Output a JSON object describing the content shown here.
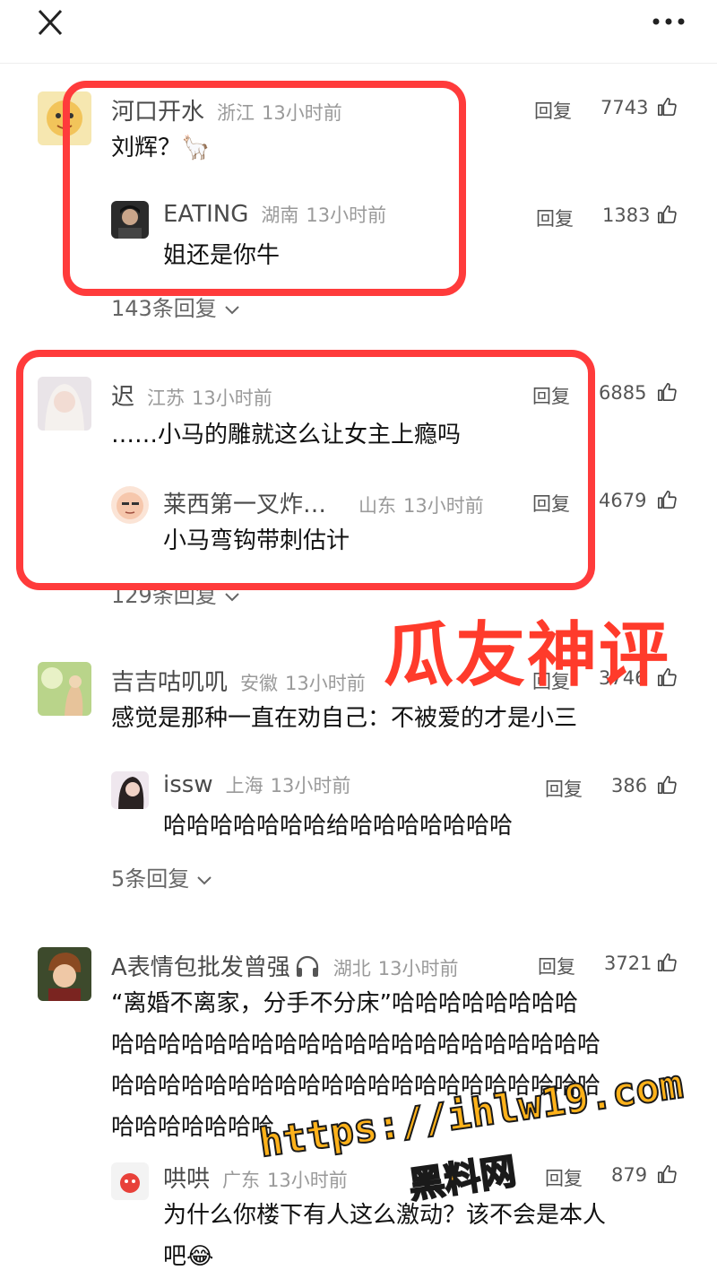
{
  "topbar": {
    "close_icon": "close-icon",
    "more_icon": "more-icon"
  },
  "labels": {
    "reply": "回复"
  },
  "comments": [
    {
      "name": "河口开水",
      "region": "浙江",
      "time": "13小时前",
      "likes": "7743",
      "text": "刘辉？🦙",
      "reply": {
        "name": "EATING",
        "region": "湖南",
        "time": "13小时前",
        "likes": "1383",
        "text": "姐还是你牛"
      },
      "more": "143条回复"
    },
    {
      "name": "迟",
      "region": "江苏",
      "time": "13小时前",
      "likes": "6885",
      "text": "……小马的雕就这么让女主上瘾吗",
      "reply": {
        "name": "莱西第一叉炸…",
        "region": "山东",
        "time": "13小时前",
        "likes": "4679",
        "text": "小马弯钩带刺估计"
      },
      "more": "129条回复"
    },
    {
      "name": "吉吉咕叽叽",
      "region": "安徽",
      "time": "13小时前",
      "likes": "3746",
      "text": "感觉是那种一直在劝自己：不被爱的才是小三",
      "reply": {
        "name": "issw",
        "region": "上海",
        "time": "13小时前",
        "likes": "386",
        "text": "哈哈哈哈哈哈哈给哈哈哈哈哈哈哈"
      },
      "more": "5条回复"
    },
    {
      "name": "A表情包批发曾强",
      "region": "湖北",
      "time": "13小时前",
      "likes": "3721",
      "text_lines": [
        "“离婚不离家，分手不分床”哈哈哈哈哈哈哈哈",
        "哈哈哈哈哈哈哈哈哈哈哈哈哈哈哈哈哈哈哈哈哈",
        "哈哈哈哈哈哈哈哈哈哈哈哈哈哈哈哈哈哈哈哈哈",
        "哈哈哈哈哈哈哈"
      ],
      "reply": {
        "name": "哄哄",
        "region": "广东",
        "time": "13小时前",
        "likes": "879",
        "text_lines": [
          "为什么你楼下有人这么激动？该不会是本人",
          "吧😂"
        ]
      }
    }
  ],
  "overlay": {
    "stamp": "瓜友神评",
    "watermark_url": "https://ihlw19.com",
    "watermark_name": "黑料网"
  },
  "colors": {
    "accent_red": "#ff3b3b",
    "watermark_orange": "#ffb21a"
  }
}
